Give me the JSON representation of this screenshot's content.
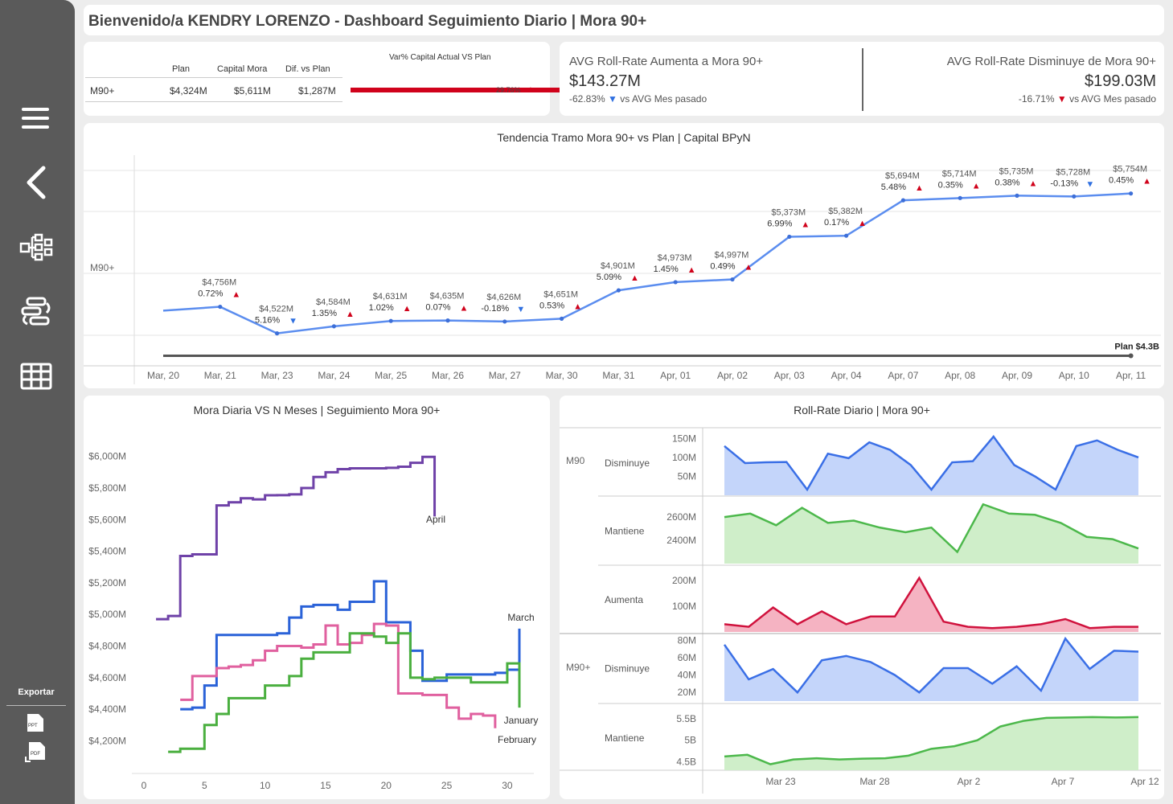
{
  "header": {
    "title": "Bienvenido/a KENDRY LORENZO - Dashboard Seguimiento Diario | Mora 90+"
  },
  "sidebar": {
    "export_label": "Exportar",
    "ppt_label": "PPT",
    "pdf_label": "PDF"
  },
  "kpi_table": {
    "columns": [
      "Plan",
      "Capital Mora",
      "Dif. vs Plan"
    ],
    "row_label": "M90+",
    "values": [
      "$4,324M",
      "$5,611M",
      "$1,287M"
    ],
    "bar_title": "Var% Capital Actual VS Plan",
    "bar_value": "29.76%",
    "bar_fraction": 0.2976,
    "bar_color": "#d0021b"
  },
  "kpi_avg": {
    "left_title": "AVG Roll-Rate Aumenta a Mora 90+",
    "left_value": "$143.27M",
    "left_change": "-62.83%",
    "left_note": "vs AVG Mes pasado",
    "right_title": "AVG Roll-Rate Disminuye de Mora 90+",
    "right_value": "$199.03M",
    "right_change": "-16.71%",
    "right_note": "vs AVG Mes pasado"
  },
  "colors": {
    "up": "#d0021b",
    "down": "#2f6fe0",
    "line": "#5b8def",
    "plan": "#555555"
  },
  "chart_data": [
    {
      "type": "line",
      "title": "Tendencia Tramo Mora 90+  vs Plan | Capital BPyN",
      "row_label": "M90+",
      "categories": [
        "Mar, 20",
        "Mar, 21",
        "Mar, 23",
        "Mar, 24",
        "Mar, 25",
        "Mar, 26",
        "Mar, 27",
        "Mar, 30",
        "Mar, 31",
        "Apr, 01",
        "Apr, 02",
        "Apr, 03",
        "Apr, 04",
        "Apr, 07",
        "Apr, 08",
        "Apr, 09",
        "Apr, 10",
        "Apr, 11"
      ],
      "values": [
        4722,
        4756,
        4522,
        4584,
        4631,
        4635,
        4626,
        4651,
        4901,
        4973,
        4997,
        5373,
        5382,
        5694,
        5714,
        5735,
        5728,
        5754
      ],
      "value_labels": [
        "",
        "$4,756M",
        "$4,522M",
        "$4,584M",
        "$4,631M",
        "$4,635M",
        "$4,626M",
        "$4,651M",
        "$4,901M",
        "$4,973M",
        "$4,997M",
        "$5,373M",
        "$5,382M",
        "$5,694M",
        "$5,714M",
        "$5,735M",
        "$5,728M",
        "$5,754M"
      ],
      "pct_labels": [
        "",
        "0.72%",
        "5.16%",
        "1.35%",
        "1.02%",
        "0.07%",
        "-0.18%",
        "0.53%",
        "5.09%",
        "1.45%",
        "0.49%",
        "6.99%",
        "0.17%",
        "5.48%",
        "0.35%",
        "0.38%",
        "-0.13%",
        "0.45%"
      ],
      "directions": [
        "",
        "up",
        "down",
        "up",
        "up",
        "up",
        "down",
        "up",
        "up",
        "up",
        "up",
        "up",
        "up",
        "up",
        "up",
        "up",
        "down",
        "up"
      ],
      "plan_label": "Plan $4.3B",
      "plan_value": 4324,
      "ylim": [
        4250,
        5950
      ]
    },
    {
      "type": "line",
      "title": "Mora Diaria VS N Meses | Seguimiento Mora 90+",
      "xlim": [
        0,
        31
      ],
      "x_ticks": [
        "0",
        "5",
        "10",
        "15",
        "20",
        "25",
        "30"
      ],
      "ylim": [
        4080,
        6080
      ],
      "y_ticks": [
        "$4,200M",
        "$4,400M",
        "$4,600M",
        "$4,800M",
        "$5,000M",
        "$5,200M",
        "$5,400M",
        "$5,600M",
        "$5,800M",
        "$6,000M"
      ],
      "series": [
        {
          "name": "April",
          "color": "#6f42a8",
          "x": [
            1,
            2,
            3,
            4,
            5,
            6,
            7,
            8,
            9,
            10,
            11,
            12,
            13,
            14,
            15,
            16,
            17,
            18,
            19,
            20,
            21,
            22,
            23,
            24
          ],
          "y": [
            4970,
            4990,
            5370,
            5380,
            5380,
            5690,
            5710,
            5735,
            5728,
            5754,
            5755,
            5760,
            5800,
            5870,
            5900,
            5920,
            5925,
            5925,
            5925,
            5928,
            5935,
            5960,
            5997,
            5620
          ]
        },
        {
          "name": "March",
          "color": "#2a62d8",
          "x": [
            3,
            4,
            5,
            6,
            7,
            8,
            9,
            10,
            11,
            12,
            13,
            14,
            15,
            16,
            17,
            18,
            19,
            20,
            21,
            22,
            23,
            24,
            25,
            26,
            27,
            28,
            29,
            30,
            31
          ],
          "y": [
            4400,
            4410,
            4550,
            4870,
            4870,
            4870,
            4870,
            4870,
            4880,
            4980,
            5050,
            5060,
            5060,
            5030,
            5080,
            5080,
            5210,
            4950,
            4950,
            4770,
            4580,
            4580,
            4620,
            4620,
            4620,
            4620,
            4630,
            4650,
            4910
          ]
        },
        {
          "name": "February",
          "color": "#e0609f",
          "x": [
            3,
            4,
            5,
            6,
            7,
            8,
            9,
            10,
            11,
            12,
            13,
            14,
            15,
            16,
            17,
            18,
            19,
            20,
            21,
            22,
            23,
            24,
            25,
            26,
            27,
            28,
            29
          ],
          "y": [
            4460,
            4610,
            4610,
            4660,
            4670,
            4680,
            4710,
            4770,
            4800,
            4800,
            4790,
            4810,
            4930,
            4810,
            4820,
            4870,
            4940,
            4930,
            4500,
            4500,
            4490,
            4490,
            4410,
            4340,
            4370,
            4360,
            4280
          ]
        },
        {
          "name": "January",
          "color": "#4aaf3f",
          "x": [
            2,
            3,
            4,
            5,
            6,
            7,
            8,
            9,
            10,
            11,
            12,
            13,
            14,
            15,
            16,
            17,
            18,
            19,
            20,
            21,
            22,
            23,
            24,
            25,
            26,
            27,
            28,
            29,
            30,
            31
          ],
          "y": [
            4130,
            4150,
            4150,
            4300,
            4370,
            4470,
            4470,
            4470,
            4550,
            4550,
            4610,
            4720,
            4760,
            4760,
            4760,
            4880,
            4880,
            4860,
            4820,
            4880,
            4600,
            4590,
            4600,
            4600,
            4600,
            4570,
            4570,
            4570,
            4690,
            4410
          ]
        }
      ]
    },
    {
      "type": "area",
      "title": "Roll-Rate Diario | Mora 90+",
      "x_ticks": [
        "Mar 23",
        "Mar 28",
        "Apr 2",
        "Apr 7",
        "Apr 12"
      ],
      "groups": [
        {
          "label": "M90",
          "rows": [
            {
              "name": "Disminuye",
              "color": "#3a6fe6",
              "fill": "#c4d5fa",
              "ylim": [
                0,
                170
              ],
              "ticks": [
                "150M",
                "100M",
                "50M"
              ],
              "tick_values": [
                150,
                100,
                50
              ],
              "values": [
                130,
                85,
                87,
                88,
                15,
                110,
                98,
                140,
                120,
                80,
                15,
                87,
                90,
                155,
                80,
                50,
                15,
                130,
                145,
                120,
                100
              ]
            },
            {
              "name": "Mantiene",
              "color": "#4cb84b",
              "fill": "#cfeec9",
              "ylim": [
                2200,
                2760
              ],
              "ticks": [
                "2600M",
                "2400M"
              ],
              "tick_values": [
                2600,
                2400
              ],
              "values": [
                2600,
                2630,
                2530,
                2680,
                2550,
                2570,
                2510,
                2470,
                2510,
                2300,
                2710,
                2630,
                2620,
                2550,
                2430,
                2410,
                2330
              ]
            },
            {
              "name": "Aumenta",
              "color": "#d0123d",
              "fill": "#f5b3c2",
              "ylim": [
                0,
                250
              ],
              "ticks": [
                "200M",
                "100M"
              ],
              "tick_values": [
                200,
                100
              ],
              "values": [
                30,
                20,
                95,
                30,
                80,
                30,
                60,
                60,
                210,
                40,
                20,
                15,
                20,
                30,
                50,
                15,
                20,
                20
              ]
            }
          ]
        },
        {
          "label": "M90+",
          "rows": [
            {
              "name": "Disminuye",
              "color": "#3a6fe6",
              "fill": "#c4d5fa",
              "ylim": [
                10,
                85
              ],
              "ticks": [
                "80M",
                "60M",
                "40M",
                "20M"
              ],
              "tick_values": [
                80,
                60,
                40,
                20
              ],
              "values": [
                75,
                35,
                47,
                20,
                57,
                62,
                55,
                40,
                20,
                48,
                48,
                30,
                50,
                22,
                82,
                47,
                68,
                67
              ]
            },
            {
              "name": "Mantiene",
              "color": "#4cb84b",
              "fill": "#cfeec9",
              "ylim": [
                4.3,
                5.8
              ],
              "ticks": [
                "5.5B",
                "5B",
                "4.5B"
              ],
              "tick_values": [
                5.5,
                5.0,
                4.5
              ],
              "values": [
                4.62,
                4.66,
                4.44,
                4.55,
                4.58,
                4.55,
                4.57,
                4.58,
                4.64,
                4.8,
                4.86,
                5.0,
                5.32,
                5.45,
                5.52,
                5.53,
                5.54,
                5.53,
                5.54
              ]
            }
          ]
        }
      ]
    }
  ]
}
